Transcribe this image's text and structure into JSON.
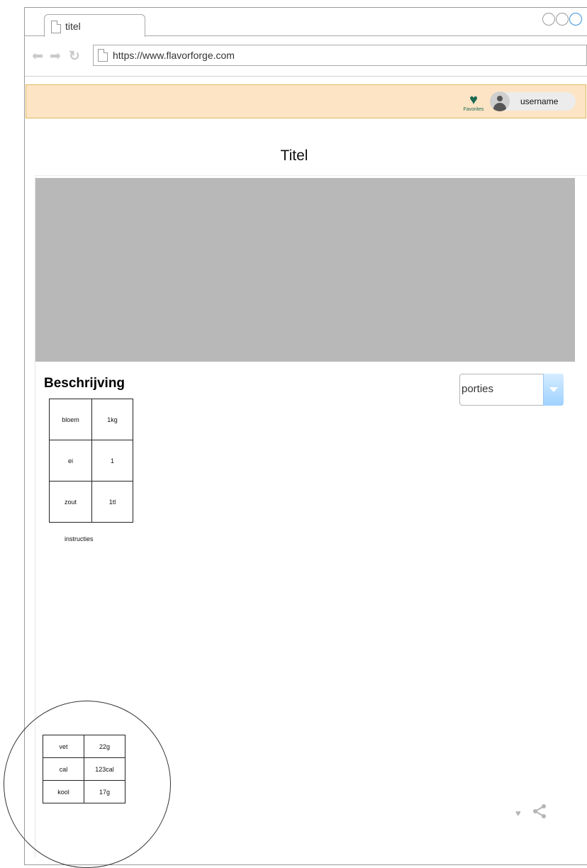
{
  "browser": {
    "tab_title": "titel",
    "url": "https://www.flavorforge.com"
  },
  "header": {
    "favorites_label": "Favorites",
    "username": "username",
    "colors": {
      "bar_background": "#fde4c4",
      "bar_border": "#e0b860",
      "heart": "#1a6a52"
    }
  },
  "page": {
    "title": "Titel",
    "description_heading": "Beschrijving",
    "portions_select": {
      "selected": "porties"
    },
    "ingredients": [
      {
        "name": "bloem",
        "amount": "1kg"
      },
      {
        "name": "ei",
        "amount": "1"
      },
      {
        "name": "zout",
        "amount": "1tl"
      }
    ],
    "instructions_label": "instructies",
    "nutrition": [
      {
        "name": "vet",
        "value": "22g"
      },
      {
        "name": "cal",
        "value": "123cal"
      },
      {
        "name": "kool",
        "value": "17g"
      }
    ],
    "actions": {
      "favorite_icon": "heart-icon",
      "share_icon": "share-icon"
    }
  }
}
